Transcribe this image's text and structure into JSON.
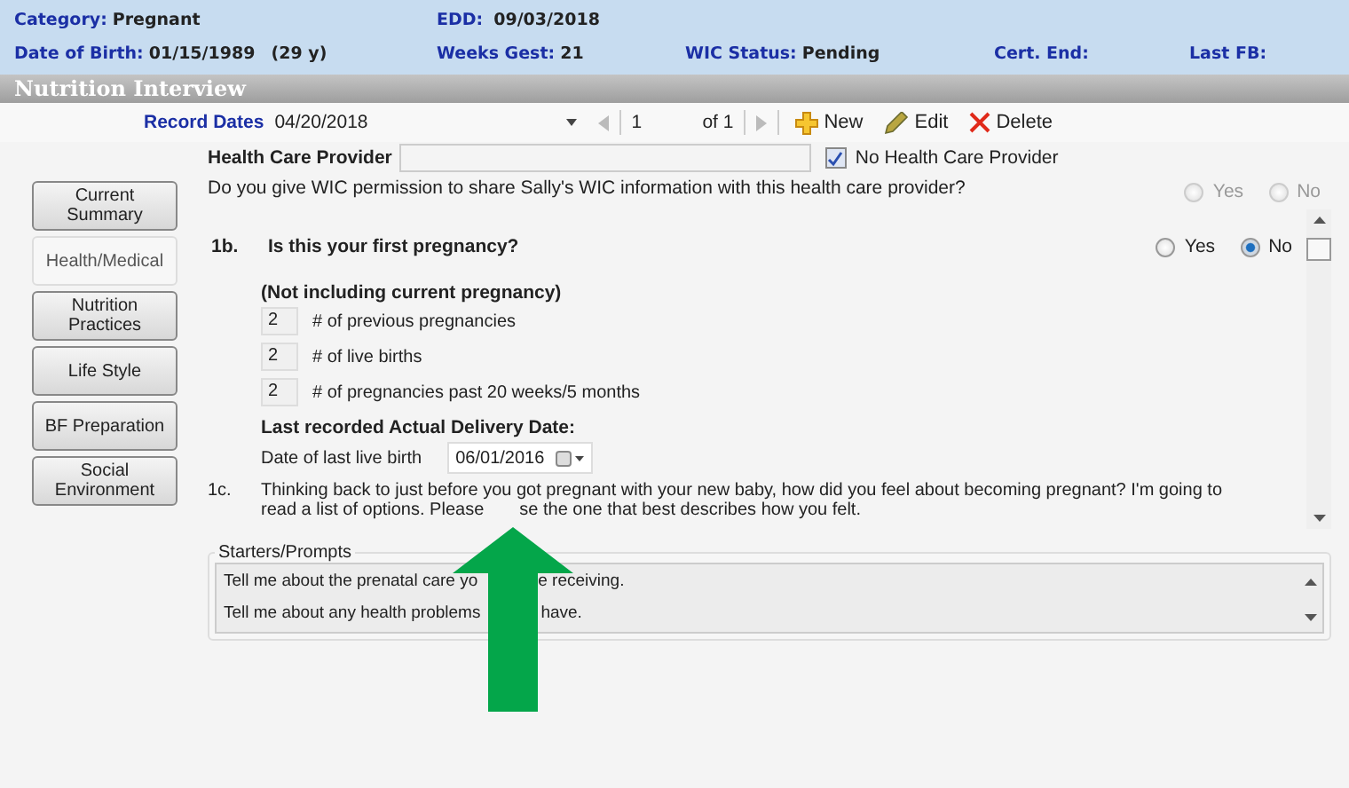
{
  "header": {
    "category_label": "Category:",
    "category": "Pregnant",
    "edd_label": "EDD:",
    "edd": "09/03/2018",
    "dob_label": "Date of Birth:",
    "dob": "01/15/1989",
    "age": "(29 y)",
    "weeks_label": "Weeks Gest:",
    "weeks": "21",
    "wic_label": "WIC Status:",
    "wic": "Pending",
    "cert_label": "Cert. End:",
    "last_fb_label": "Last FB:"
  },
  "title": "Nutrition Interview",
  "toolbar": {
    "record_dates_label": "Record Dates",
    "record_date": "04/20/2018",
    "page": "1",
    "of": "of 1",
    "actions": [
      {
        "kind": "add",
        "label": "New"
      },
      {
        "kind": "edit",
        "label": "Edit"
      },
      {
        "kind": "delete",
        "label": "Delete"
      }
    ]
  },
  "sidebar": [
    {
      "label": "Current Summary",
      "selected": false
    },
    {
      "label": "Health/Medical",
      "selected": true
    },
    {
      "label": "Nutrition Practices",
      "selected": false
    },
    {
      "label": "Life Style",
      "selected": false
    },
    {
      "label": "BF Preparation",
      "selected": false
    },
    {
      "label": "Social Environment",
      "selected": false
    }
  ],
  "provider": {
    "label": "Health Care Provider",
    "checkbox": {
      "label": "No Health Care Provider",
      "checked": true
    }
  },
  "permission": {
    "question": "Do you give WIC permission to share Sally's WIC information with this health care provider?",
    "options": [
      {
        "label": "Yes",
        "selected": false,
        "disabled": true
      },
      {
        "label": "No",
        "selected": false,
        "disabled": true
      }
    ]
  },
  "q1b": {
    "number": "1b.",
    "question": "Is this your first pregnancy?",
    "options": [
      {
        "label": "Yes",
        "selected": false,
        "disabled": false
      },
      {
        "label": "No",
        "selected": true,
        "disabled": false
      }
    ],
    "subheading": "(Not including current pregnancy)",
    "counts": [
      {
        "value": "2",
        "label": "# of previous pregnancies"
      },
      {
        "value": "2",
        "label": "# of live births"
      },
      {
        "value": "2",
        "label": "# of pregnancies past 20 weeks/5 months"
      }
    ],
    "delivery_heading": "Last recorded Actual Delivery Date:",
    "date_label": "Date of last live birth",
    "date_value": "06/01/2016"
  },
  "q1c": {
    "number": "1c.",
    "lines": [
      [
        "Thinking back to just before you got pregnant with your new baby, how did you feel about becoming pregnant? I'm going to"
      ],
      [
        "read a list of options. Please",
        "se the one that best describes how you felt."
      ]
    ]
  },
  "prompts": {
    "title": "Starters/Prompts",
    "items": [
      [
        "Tell me about the prenatal care yo",
        "e receiving."
      ],
      [
        "Tell me about any health problems",
        "have."
      ]
    ]
  }
}
